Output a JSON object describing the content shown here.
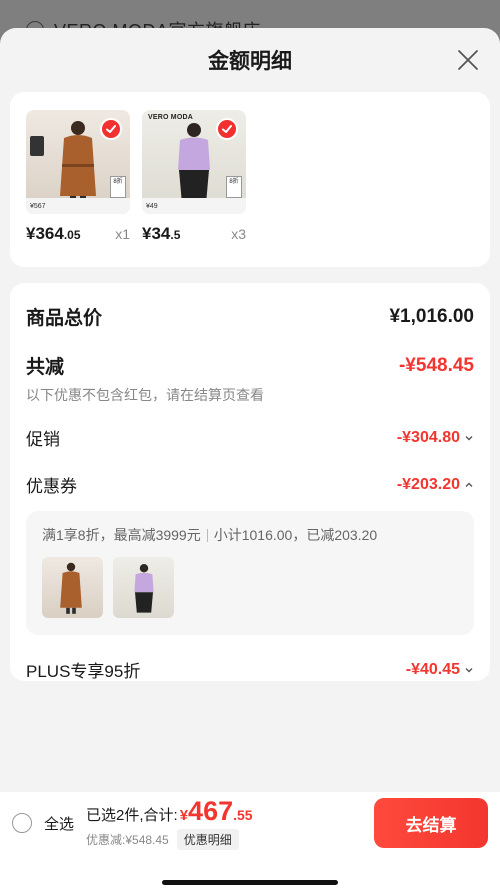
{
  "background": {
    "store_name": "VERO MODA官方旗舰店 ›"
  },
  "sheet": {
    "title": "金额明细",
    "close_icon": "close-icon"
  },
  "products": [
    {
      "price_int": "¥364",
      "price_dec": ".05",
      "qty": "x1",
      "brand": "",
      "strip_price": "¥567",
      "tag": "8折"
    },
    {
      "price_int": "¥34",
      "price_dec": ".5",
      "qty": "x3",
      "brand": "VERO MODA",
      "strip_price": "¥49",
      "tag": "8折"
    }
  ],
  "summary": {
    "total_label": "商品总价",
    "total_value": "¥1,016.00",
    "reduce_label": "共减",
    "reduce_value": "-¥548.45",
    "reduce_note": "以下优惠不包含红包，请在结算页查看",
    "promo_label": "促销",
    "promo_value": "-¥304.80",
    "coupon_label": "优惠券",
    "coupon_value": "-¥203.20",
    "coupon_desc": "满1享8折，最高减3999元",
    "coupon_subtotal": "小计1016.00，已减203.20",
    "plus_label": "PLUS专享95折",
    "plus_value": "-¥40.45"
  },
  "bottom": {
    "select_all": "全选",
    "selected_text": "已选2件,合计:",
    "currency": "¥",
    "total_int": "467",
    "total_dec": ".55",
    "discount_text": "优惠减:¥548.45",
    "detail_label": "优惠明细",
    "checkout_label": "去结算"
  },
  "colors": {
    "accent_red": "#f2362f",
    "badge_red": "#f23030"
  }
}
